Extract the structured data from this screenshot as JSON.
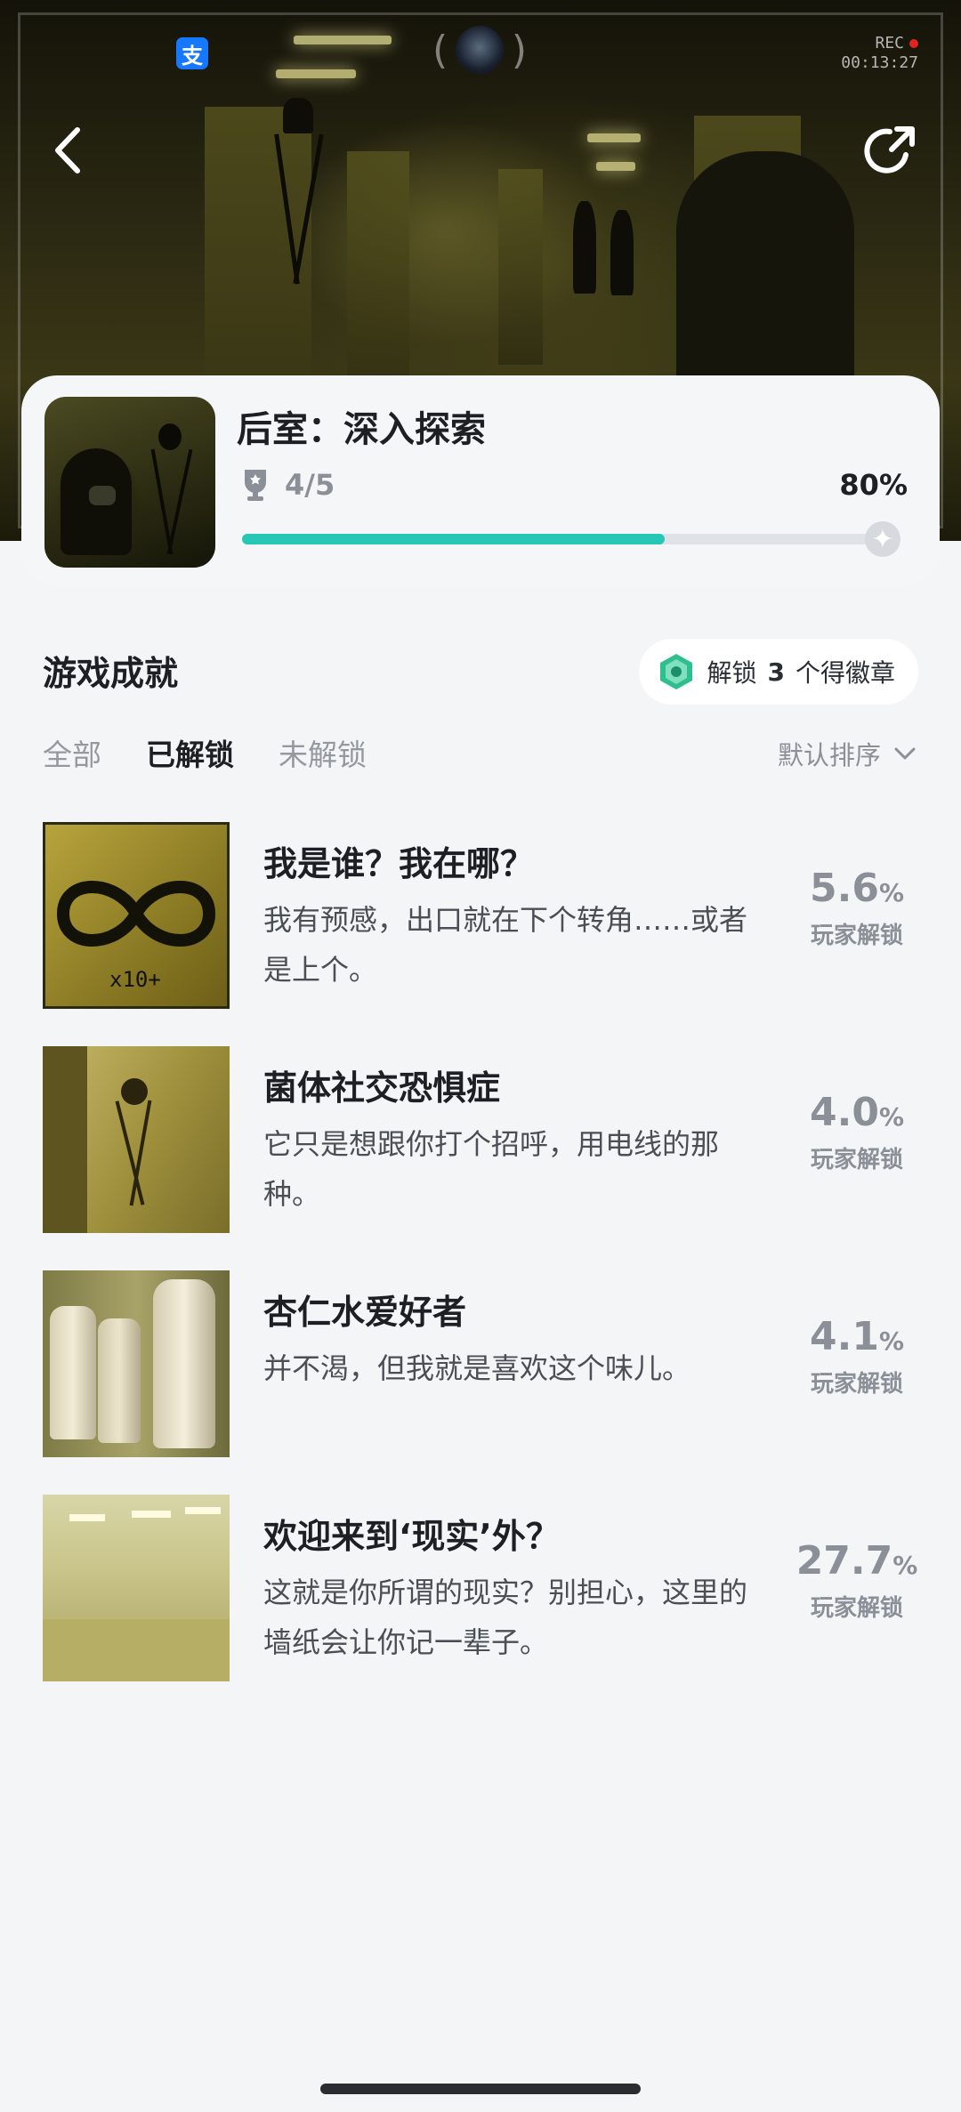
{
  "status_bar": {
    "rec_label": "REC",
    "rec_time": "00:13:27"
  },
  "game": {
    "title": "后室：深入探索",
    "achievements_count": "4/5",
    "progress_text": "80%",
    "progress": 0.8
  },
  "section": {
    "title": "游戏成就",
    "badge_prefix": "解锁",
    "badge_number": "3",
    "badge_suffix": "个得徽章"
  },
  "tabs": [
    {
      "label": "全部",
      "active": false
    },
    {
      "label": "已解锁",
      "active": true
    },
    {
      "label": "未解锁",
      "active": false
    }
  ],
  "sort_label": "默认排序",
  "achievements": [
    {
      "title": "我是谁？我在哪？",
      "desc": "我有预感，出口就在下个转角……或者是上个。",
      "rate": "5.6",
      "unit": "%",
      "rate_label": "玩家解锁",
      "image_text": "x10+"
    },
    {
      "title": "菌体社交恐惧症",
      "desc": "它只是想跟你打个招呼，用电线的那种。",
      "rate": "4.0",
      "unit": "%",
      "rate_label": "玩家解锁"
    },
    {
      "title": "杏仁水爱好者",
      "desc": "并不渴，但我就是喜欢这个味儿。",
      "rate": "4.1",
      "unit": "%",
      "rate_label": "玩家解锁"
    },
    {
      "title": "欢迎来到‘现实’外？",
      "desc": "这就是你所谓的现实？别担心，这里的墙纸会让你记一辈子。",
      "rate": "27.7",
      "unit": "%",
      "rate_label": "玩家解锁"
    }
  ],
  "colors": {
    "accent": "#26c7b4",
    "background": "#f4f5f7",
    "muted": "#8a8f98"
  }
}
